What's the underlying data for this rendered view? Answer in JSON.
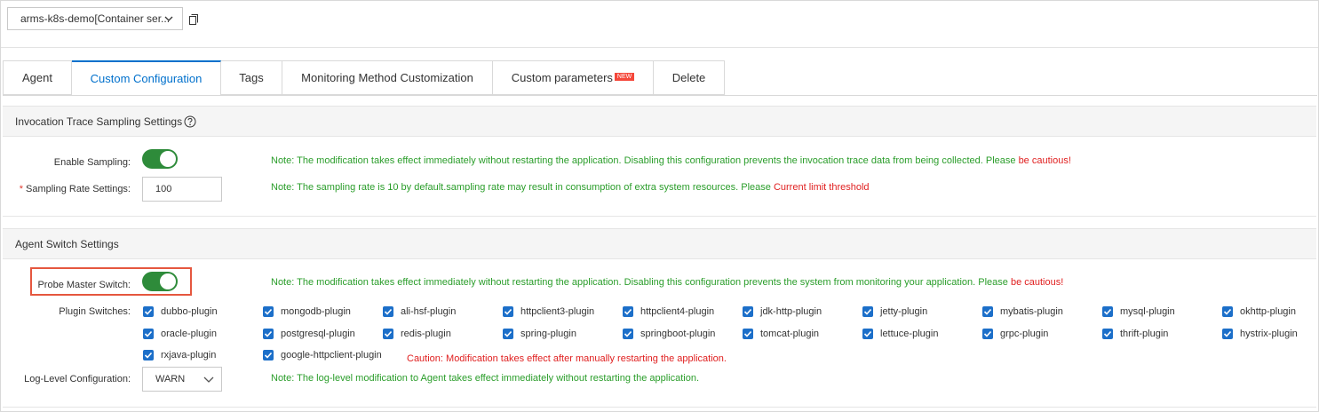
{
  "app_selector": {
    "value": "arms-k8s-demo[Container ser..."
  },
  "tabs": [
    {
      "label": "Agent"
    },
    {
      "label": "Custom Configuration",
      "active": true
    },
    {
      "label": "Tags"
    },
    {
      "label": "Monitoring Method Customization"
    },
    {
      "label": "Custom parameters",
      "badge": "NEW"
    },
    {
      "label": "Delete"
    }
  ],
  "sampling": {
    "title": "Invocation Trace Sampling Settings",
    "enable_label": "Enable Sampling:",
    "enable_state": true,
    "enable_note": "Note: The modification takes effect immediately without restarting the application. Disabling this configuration prevents the invocation trace data from being collected. Please ",
    "enable_note_warn": "be cautious!",
    "rate_required": "*",
    "rate_label": "Sampling Rate Settings:",
    "rate_value": "100",
    "rate_note": "Note: The sampling rate is 10 by default.sampling rate may result in consumption of extra system resources. Please ",
    "rate_note_warn": "Current limit threshold"
  },
  "agent": {
    "title": "Agent Switch Settings",
    "probe_label": "Probe Master Switch:",
    "probe_state": true,
    "probe_note": "Note: The modification takes effect immediately without restarting the application. Disabling this configuration prevents the system from monitoring your application. Please ",
    "probe_note_warn": "be cautious!",
    "plugins_label": "Plugin Switches:",
    "plugins": [
      "dubbo-plugin",
      "mongodb-plugin",
      "ali-hsf-plugin",
      "httpclient3-plugin",
      "httpclient4-plugin",
      "jdk-http-plugin",
      "jetty-plugin",
      "mybatis-plugin",
      "mysql-plugin",
      "okhttp-plugin",
      "oracle-plugin",
      "postgresql-plugin",
      "redis-plugin",
      "spring-plugin",
      "springboot-plugin",
      "tomcat-plugin",
      "lettuce-plugin",
      "grpc-plugin",
      "thrift-plugin",
      "hystrix-plugin",
      "rxjava-plugin",
      "google-httpclient-plugin"
    ],
    "plugins_caution": "Caution: Modification takes effect after manually restarting the application.",
    "log_label": "Log-Level Configuration:",
    "log_value": "WARN",
    "log_note": "Note: The log-level modification to Agent takes effect immediately without restarting the application."
  },
  "colors": {
    "accent": "#0070cc",
    "switch_on": "#2e8b3a",
    "note": "#2a9d2a",
    "warn": "#e02020",
    "checkbox": "#1c6fc9"
  }
}
